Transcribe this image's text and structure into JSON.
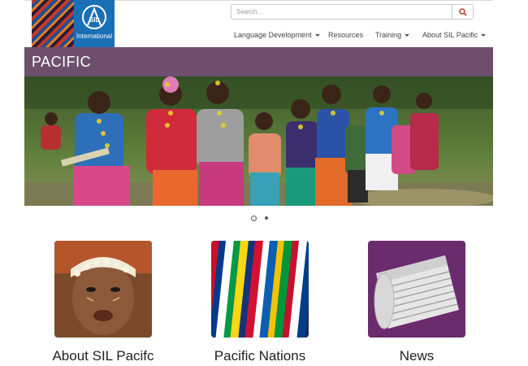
{
  "logo": {
    "text": "International",
    "mark": "SIL",
    "icon": "sil-logo-icon"
  },
  "search": {
    "placeholder": "Search...",
    "icon": "search-icon"
  },
  "nav": {
    "items": [
      {
        "label": "Language Development",
        "dropdown": true
      },
      {
        "label": "Resources",
        "dropdown": false
      },
      {
        "label": "Training",
        "dropdown": true
      },
      {
        "label": "About SIL Pacific",
        "dropdown": true
      }
    ]
  },
  "banner": {
    "title": "PACIFIC"
  },
  "carousel": {
    "slide_count": 2,
    "active_index": 0
  },
  "cards": [
    {
      "label": "About SIL Pacifc",
      "image": "portrait-with-shell-headdress"
    },
    {
      "label": "Pacific Nations",
      "image": "pacific-flags"
    },
    {
      "label": "News",
      "image": "rolled-newspaper"
    }
  ],
  "colors": {
    "banner": "#6d4f6d",
    "logo_blue": "#1b6fb5",
    "search_icon": "#c0392b"
  }
}
